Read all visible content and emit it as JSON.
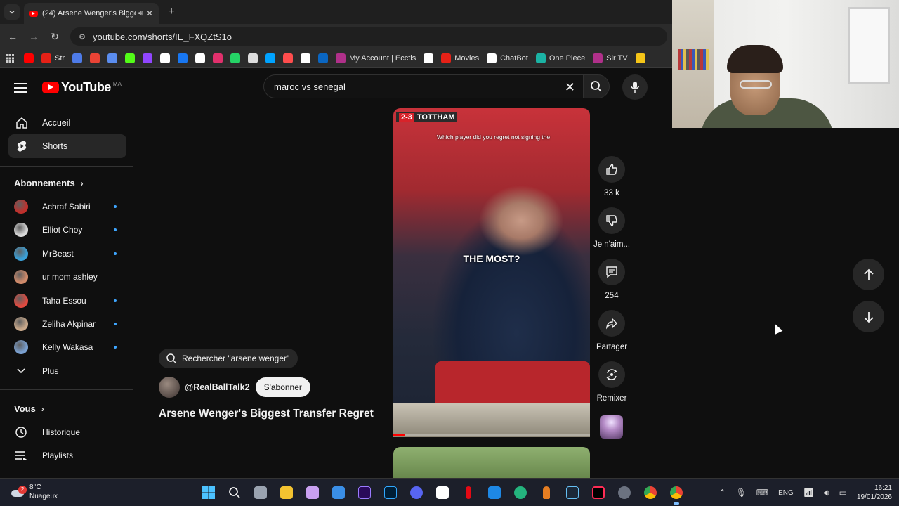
{
  "browser": {
    "tab_title": "(24) Arsene Wenger's Bigge",
    "url": "youtube.com/shorts/IE_FXQZtS1o",
    "bookmarks": [
      {
        "label": "",
        "color": "#ff0000"
      },
      {
        "label": "Str",
        "color": "#e62117"
      },
      {
        "label": "",
        "color": "#4e7be8"
      },
      {
        "label": "",
        "color": "#ea4335"
      },
      {
        "label": "",
        "color": "#5b8def"
      },
      {
        "label": "",
        "color": "#53fc18"
      },
      {
        "label": "",
        "color": "#9146ff"
      },
      {
        "label": "",
        "color": "#ffffff"
      },
      {
        "label": "",
        "color": "#1877f2"
      },
      {
        "label": "",
        "color": "#ffffff"
      },
      {
        "label": "",
        "color": "#e1306c"
      },
      {
        "label": "",
        "color": "#25d366"
      },
      {
        "label": "",
        "color": "#dddddd"
      },
      {
        "label": "",
        "color": "#00a3ff"
      },
      {
        "label": "",
        "color": "#ff4d4d"
      },
      {
        "label": "",
        "color": "#ffffff"
      },
      {
        "label": "",
        "color": "#0a66c2"
      },
      {
        "label": "My Account | Ecctis",
        "color": "#b0308a"
      },
      {
        "label": "",
        "color": "#ffffff"
      },
      {
        "label": "Movies",
        "color": "#e62117"
      },
      {
        "label": "ChatBot",
        "color": "#ffffff"
      },
      {
        "label": "One Piece",
        "color": "#1bb3a4"
      },
      {
        "label": "Sir TV",
        "color": "#b0308a"
      },
      {
        "label": "",
        "color": "#f5c518"
      }
    ]
  },
  "youtube": {
    "wordmark": "YouTube",
    "country": "MA",
    "search_value": "maroc vs senegal",
    "nav": [
      {
        "label": "Accueil",
        "icon": "home-icon"
      },
      {
        "label": "Shorts",
        "icon": "shorts-icon"
      }
    ],
    "subscriptions_title": "Abonnements",
    "subscriptions": [
      {
        "name": "Achraf Sabiri",
        "color": "#c0302c",
        "dot": true
      },
      {
        "name": "Elliot Choy",
        "color": "#d8d8d8",
        "dot": true
      },
      {
        "name": "MrBeast",
        "color": "#3aa0d8",
        "dot": true
      },
      {
        "name": "ur mom ashley",
        "color": "#d08a6a",
        "dot": false
      },
      {
        "name": "Taha Essou",
        "color": "#e04a40",
        "dot": true
      },
      {
        "name": "Zeliha Akpinar",
        "color": "#c8a88a",
        "dot": true
      },
      {
        "name": "Kelly Wakasa",
        "color": "#7aa0d0",
        "dot": true
      }
    ],
    "more_label": "Plus",
    "you_title": "Vous",
    "you_items": [
      {
        "label": "Historique"
      },
      {
        "label": "Playlists"
      }
    ],
    "short": {
      "search_chip": "Rechercher \"arsene wenger\"",
      "channel": "@RealBallTalk2",
      "subscribe": "S'abonner",
      "title": "Arsene Wenger's Biggest Transfer Regret",
      "score_team": "TOTTHAM",
      "score": "2-3",
      "caption_top": "Which player did you regret not signing the",
      "caption_main": "THE MOST?",
      "progress": 0.06,
      "actions": {
        "like": "33 k",
        "dislike": "Je n'aim...",
        "comments": "254",
        "share": "Partager",
        "remix": "Remixer"
      }
    }
  },
  "taskbar": {
    "temperature": "8°C",
    "weather": "Nuageux",
    "weather_badge": "2",
    "language": "ENG",
    "time": "16:21",
    "date": "19/01/2026"
  }
}
